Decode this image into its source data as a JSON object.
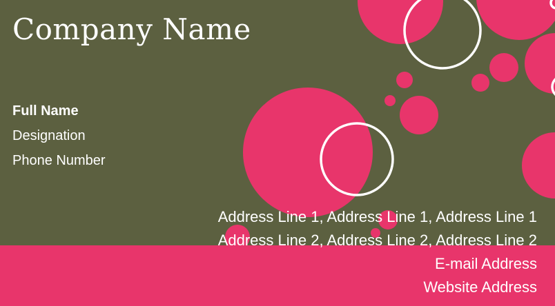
{
  "colors": {
    "background": "#5c6040",
    "accent": "#e8356b",
    "text": "#ffffff"
  },
  "card": {
    "company": "Company Name",
    "full_name": "Full Name",
    "designation": "Designation",
    "phone": "Phone Number",
    "address_line_1": "Address Line 1,  Address Line 1,  Address Line 1",
    "address_line_2": "Address Line 2,  Address Line 2,  Address Line 2",
    "email": "E-mail Address",
    "website": "Website Address"
  }
}
